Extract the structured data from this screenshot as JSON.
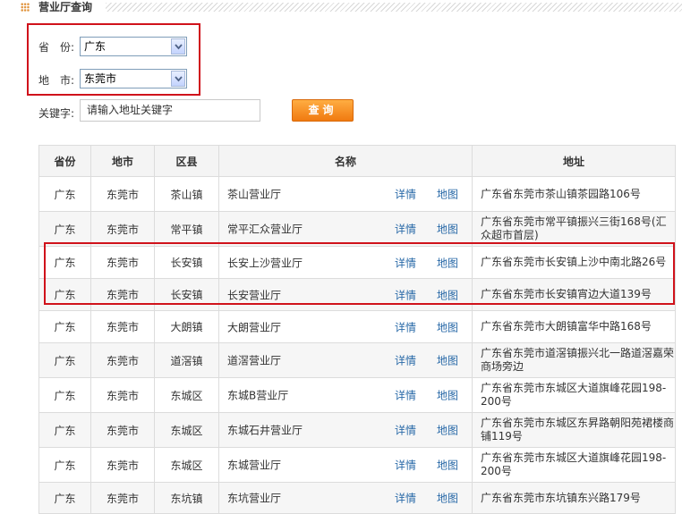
{
  "header": {
    "title": "营业厅查询"
  },
  "form": {
    "province_label": "省　份:",
    "province_value": "广东",
    "city_label": "地　市:",
    "city_value": "东莞市",
    "keyword_label": "关键字:",
    "keyword_placeholder": "请输入地址关键字",
    "query_button": "查询"
  },
  "table": {
    "headers": [
      "省份",
      "地市",
      "区县",
      "名称",
      "地址"
    ],
    "detail_link": "详情",
    "map_link": "地图",
    "rows": [
      {
        "province": "广东",
        "city": "东莞市",
        "district": "茶山镇",
        "name": "茶山营业厅",
        "address": "广东省东莞市茶山镇茶园路106号"
      },
      {
        "province": "广东",
        "city": "东莞市",
        "district": "常平镇",
        "name": "常平汇众营业厅",
        "address": "广东省东莞市常平镇振兴三街168号(汇众超市首层)"
      },
      {
        "province": "广东",
        "city": "东莞市",
        "district": "长安镇",
        "name": "长安上沙营业厅",
        "address": "广东省东莞市长安镇上沙中南北路26号"
      },
      {
        "province": "广东",
        "city": "东莞市",
        "district": "长安镇",
        "name": "长安营业厅",
        "address": "广东省东莞市长安镇宵边大道139号"
      },
      {
        "province": "广东",
        "city": "东莞市",
        "district": "大朗镇",
        "name": "大朗营业厅",
        "address": "广东省东莞市大朗镇富华中路168号"
      },
      {
        "province": "广东",
        "city": "东莞市",
        "district": "道滘镇",
        "name": "道滘营业厅",
        "address": "广东省东莞市道滘镇振兴北一路道滘嘉荣商场旁边"
      },
      {
        "province": "广东",
        "city": "东莞市",
        "district": "东城区",
        "name": "东城B营业厅",
        "address": "广东省东莞市东城区大道旗峰花园198-200号"
      },
      {
        "province": "广东",
        "city": "东莞市",
        "district": "东城区",
        "name": "东城石井营业厅",
        "address": "广东省东莞市东城区东昇路朝阳苑裙楼商铺119号"
      },
      {
        "province": "广东",
        "city": "东莞市",
        "district": "东城区",
        "name": "东城营业厅",
        "address": "广东省东莞市东城区大道旗峰花园198-200号"
      },
      {
        "province": "广东",
        "city": "东莞市",
        "district": "东坑镇",
        "name": "东坑营业厅",
        "address": "广东省东莞市东坑镇东兴路179号"
      }
    ]
  },
  "colors": {
    "accent_red": "#d0121b",
    "button_orange": "#f07a10",
    "link_blue": "#2a6aa8"
  }
}
